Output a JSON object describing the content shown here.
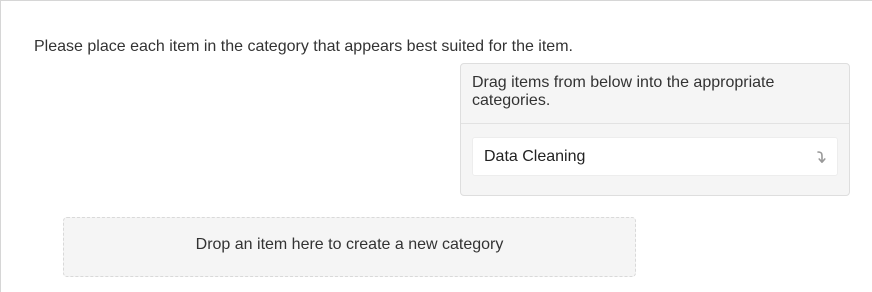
{
  "question": {
    "prompt": "Please place each item in the category that appears best suited for the item."
  },
  "item_pool": {
    "header": "Drag items from below into the appropriate categories.",
    "items": [
      {
        "label": "Data Cleaning",
        "icon": "drag-handle-icon"
      }
    ]
  },
  "new_category_zone": {
    "label": "Drop an item here to create a new category"
  }
}
